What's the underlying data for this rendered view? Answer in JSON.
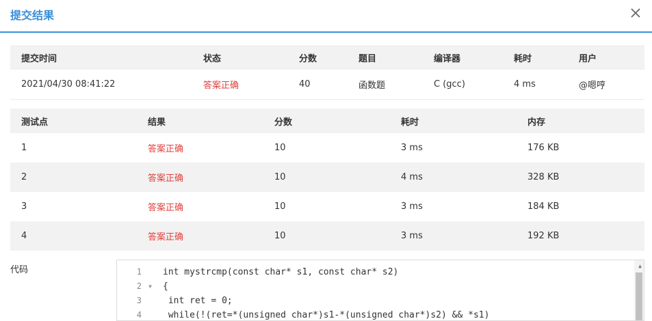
{
  "dialog": {
    "title": "提交结果",
    "close_icon": "close-icon"
  },
  "summary": {
    "headers": [
      "提交时间",
      "状态",
      "分数",
      "题目",
      "编译器",
      "耗时",
      "用户"
    ],
    "row": [
      "2021/04/30 08:41:22",
      "答案正确",
      "40",
      "函数题",
      "C (gcc)",
      "4 ms",
      "@嗯哼"
    ]
  },
  "cases": {
    "headers": [
      "测试点",
      "结果",
      "分数",
      "耗时",
      "内存"
    ],
    "rows": [
      [
        "1",
        "答案正确",
        "10",
        "3 ms",
        "176 KB"
      ],
      [
        "2",
        "答案正确",
        "10",
        "4 ms",
        "328 KB"
      ],
      [
        "3",
        "答案正确",
        "10",
        "3 ms",
        "184 KB"
      ],
      [
        "4",
        "答案正确",
        "10",
        "3 ms",
        "192 KB"
      ]
    ]
  },
  "code": {
    "label": "代码",
    "line_numbers": [
      "1",
      "2",
      "3",
      "4"
    ],
    "lines": [
      "int mystrcmp(const char* s1, const char* s2)",
      "{",
      " int ret = 0;",
      " while(!(ret=*(unsigned char*)s1-*(unsigned char*)s2) && *s1)"
    ]
  },
  "colors": {
    "accent": "#3b8fd8",
    "accepted": "#e0413e",
    "header_bg": "#f2f2f2"
  }
}
